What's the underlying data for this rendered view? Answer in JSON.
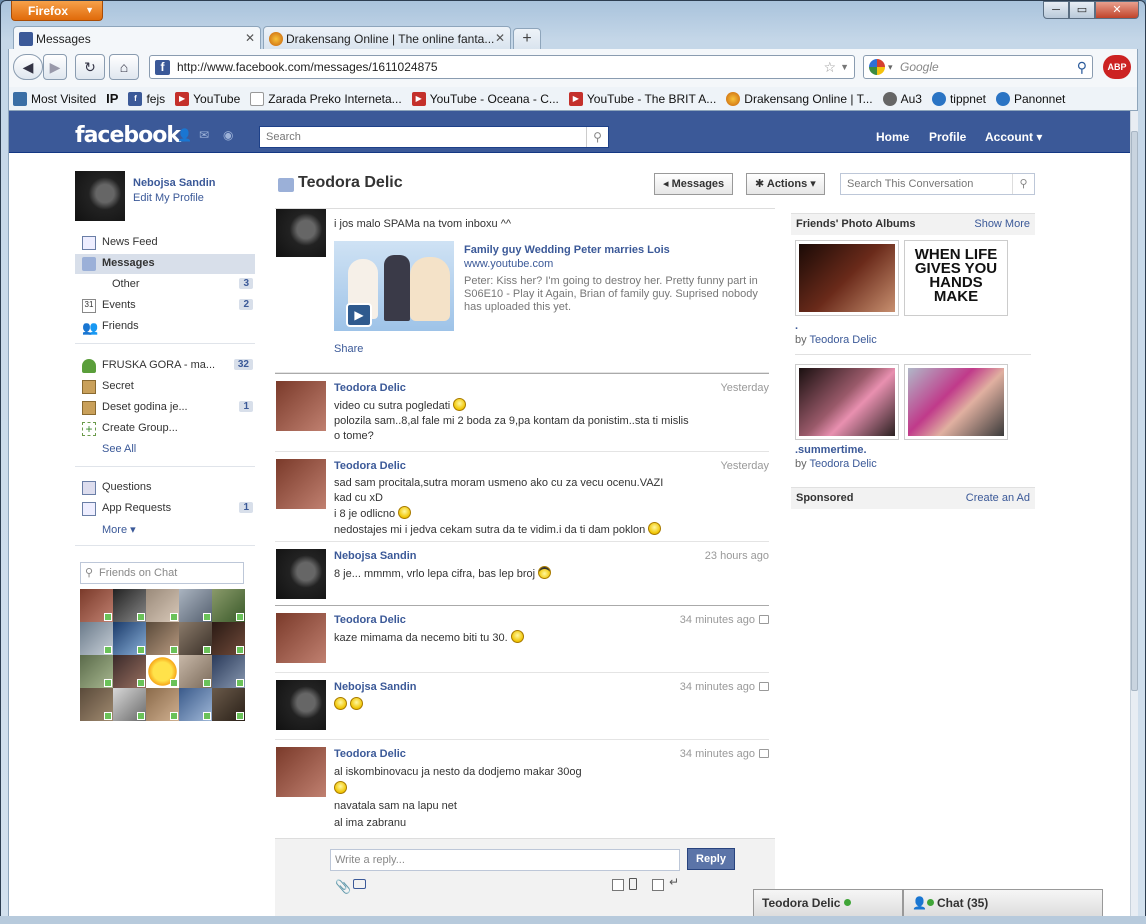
{
  "browser": {
    "app_button": "Firefox",
    "tabs": [
      {
        "title": "Messages",
        "active": true
      },
      {
        "title": "Drakensang Online | The online fanta...",
        "active": false
      }
    ],
    "url": "http://www.facebook.com/messages/1611024875",
    "search_placeholder": "Google",
    "abp_label": "ABP",
    "bookmarks": [
      {
        "label": "Most Visited",
        "icon": "star-folder-icon"
      },
      {
        "label": "IP",
        "icon": ""
      },
      {
        "label": "fejs",
        "icon": "facebook-icon"
      },
      {
        "label": "YouTube",
        "icon": "youtube-icon"
      },
      {
        "label": "Zarada Preko Interneta...",
        "icon": "page-icon"
      },
      {
        "label": "YouTube - Oceana - C...",
        "icon": "youtube-icon"
      },
      {
        "label": "YouTube - The BRIT A...",
        "icon": "youtube-icon"
      },
      {
        "label": "Drakensang Online | T...",
        "icon": "drakensang-icon"
      },
      {
        "label": "Au3",
        "icon": "au3-icon"
      },
      {
        "label": "tippnet",
        "icon": "globe-icon"
      },
      {
        "label": "Panonnet",
        "icon": "globe-icon"
      }
    ]
  },
  "fb": {
    "logo": "facebook",
    "search_placeholder": "Search",
    "top_links": [
      "Home",
      "Profile",
      "Account"
    ],
    "profile": {
      "name": "Nebojsa Sandin",
      "edit": "Edit My Profile"
    },
    "nav": [
      {
        "label": "News Feed",
        "count": ""
      },
      {
        "label": "Messages",
        "count": ""
      },
      {
        "label": "Other",
        "count": "3"
      },
      {
        "label": "Events",
        "count": "2"
      },
      {
        "label": "Friends",
        "count": ""
      }
    ],
    "groups": [
      {
        "label": "FRUSKA GORA - ma...",
        "count": "32"
      },
      {
        "label": "Secret",
        "count": ""
      },
      {
        "label": "Deset godina je...",
        "count": "1"
      },
      {
        "label": "Create Group...",
        "count": ""
      }
    ],
    "see_all": "See All",
    "apps": [
      {
        "label": "Questions",
        "count": ""
      },
      {
        "label": "App Requests",
        "count": "1"
      }
    ],
    "more": "More",
    "chat_search_placeholder": "Friends on Chat",
    "thread": {
      "title": "Teodora Delic",
      "messages_btn": "Messages",
      "actions_btn": "Actions",
      "search_placeholder": "Search This Conversation"
    },
    "first_message": {
      "text": "i jos malo SPAMa na tvom inboxu ^^",
      "link_title": "Family guy Wedding Peter marries Lois",
      "link_url": "www.youtube.com",
      "link_desc": "Peter: Kiss her? I'm going to destroy her. Pretty funny part in S06E10 - Play it Again, Brian of family guy. Suprised nobody has uploaded this yet.",
      "share": "Share"
    },
    "messages": [
      {
        "name": "Teodora Delic",
        "time": "Yesterday",
        "lines": [
          "video cu sutra pogledati",
          "polozila sam..8,al fale mi 2 boda za 9,pa kontam da ponistim..sta ti mislis o tome?"
        ]
      },
      {
        "name": "Teodora Delic",
        "time": "Yesterday",
        "lines": [
          "sad sam procitala,sutra moram usmeno ako cu za vecu ocenu.VAZI kad cu xD",
          "i 8 je odlicno",
          "nedostajes mi i jedva cekam sutra da te vidim.i da ti dam poklon"
        ]
      },
      {
        "name": "Nebojsa Sandin",
        "time": "23 hours ago",
        "lines": [
          "8 je... mmmm, vrlo lepa cifra, bas lep broj"
        ]
      },
      {
        "name": "Teodora Delic",
        "time": "34 minutes ago",
        "lines": [
          "kaze mimama da necemo biti tu 30."
        ]
      },
      {
        "name": "Nebojsa Sandin",
        "time": "34 minutes ago",
        "lines": [
          ""
        ]
      },
      {
        "name": "Teodora Delic",
        "time": "34 minutes ago",
        "lines": [
          "al iskombinovacu ja nesto da dodjemo makar 30og",
          "",
          "navatala sam na lapu net",
          "al ima zabranu"
        ]
      }
    ],
    "reply_placeholder": "Write a reply...",
    "reply_btn": "Reply",
    "albums_header": "Friends' Photo Albums",
    "show_more": "Show More",
    "albums": [
      {
        "title": ".",
        "by": "by",
        "author": "Teodora Delic"
      },
      {
        "title": ".summertime.",
        "by": "by",
        "author": "Teodora Delic"
      }
    ],
    "sponsored": "Sponsored",
    "create_ad": "Create an Ad",
    "chat_tab": "Teodora Delic",
    "chat_count": "Chat (35)"
  }
}
